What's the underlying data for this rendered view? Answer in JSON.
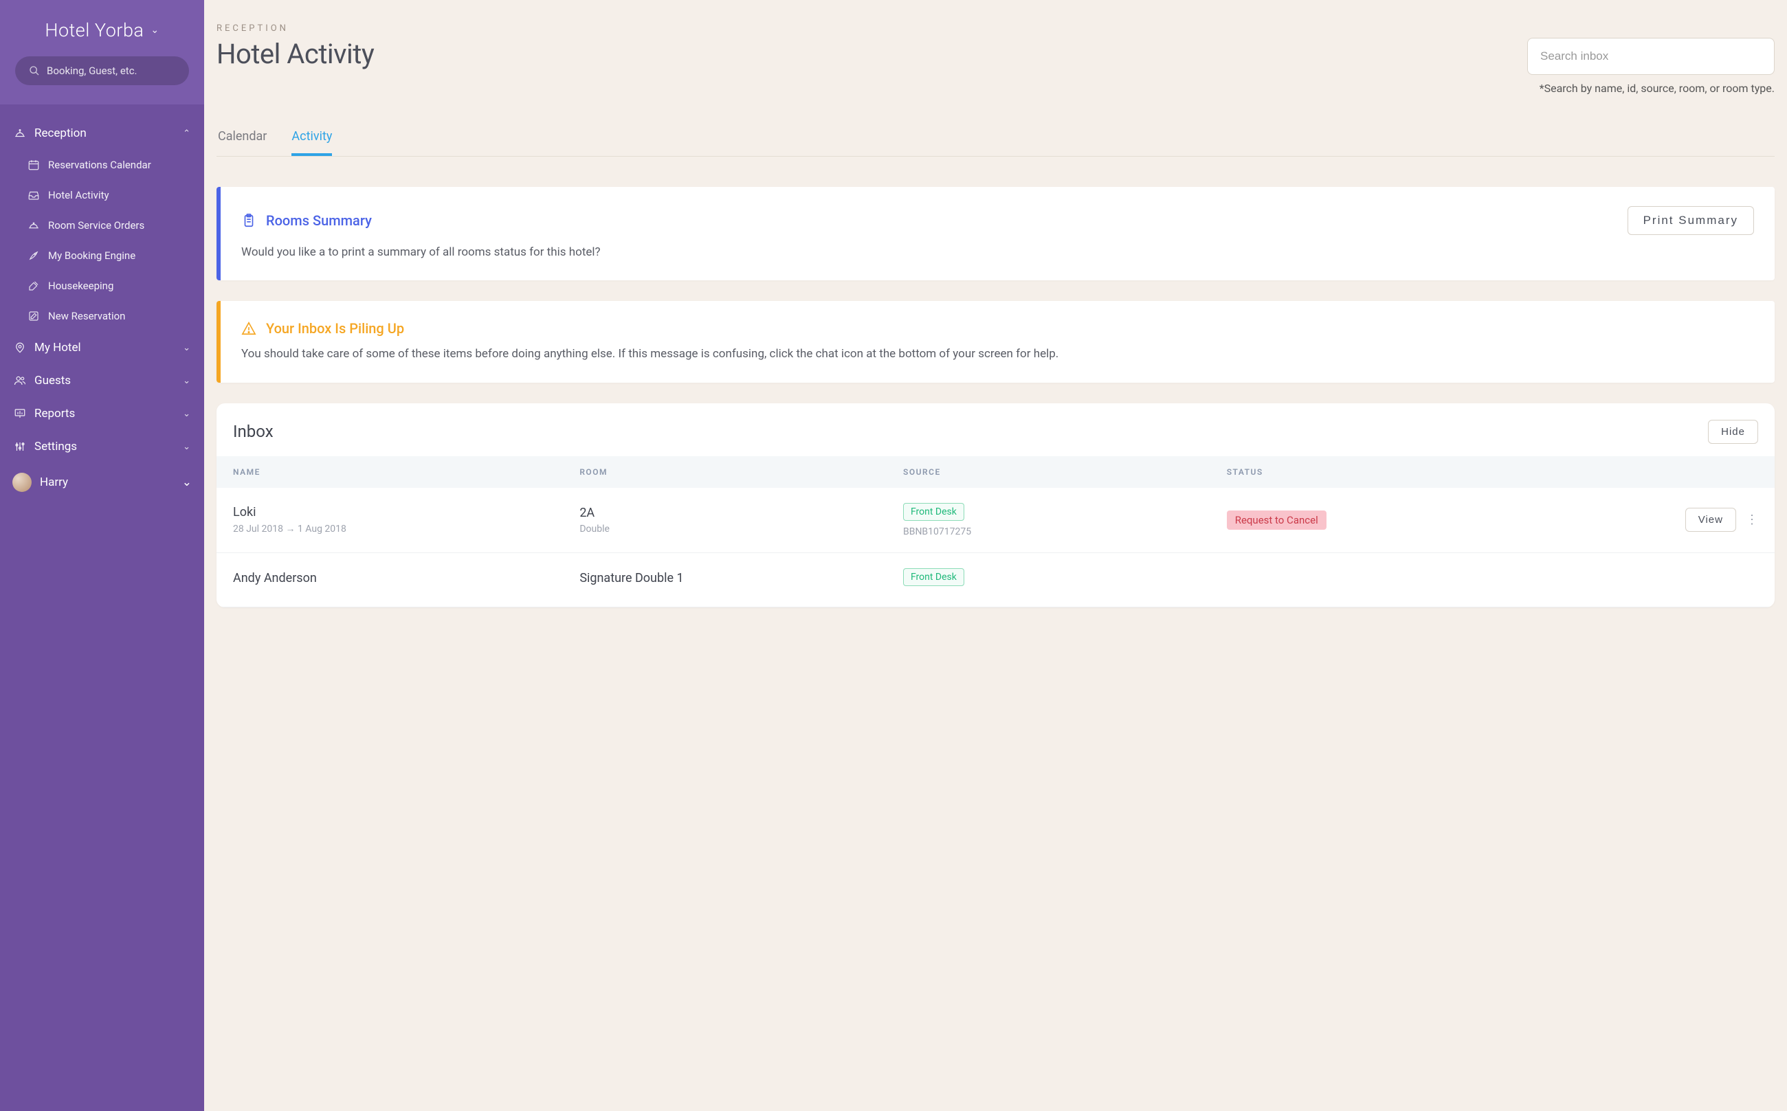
{
  "sidebar": {
    "hotel_name": "Hotel Yorba",
    "search_placeholder": "Booking, Guest, etc.",
    "nav": [
      {
        "label": "Reception",
        "expanded": true,
        "children": [
          {
            "label": "Reservations Calendar"
          },
          {
            "label": "Hotel Activity"
          },
          {
            "label": "Room Service Orders"
          },
          {
            "label": "My Booking Engine"
          },
          {
            "label": "Housekeeping"
          },
          {
            "label": "New Reservation"
          }
        ]
      },
      {
        "label": "My Hotel",
        "expanded": false
      },
      {
        "label": "Guests",
        "expanded": false
      },
      {
        "label": "Reports",
        "expanded": false
      },
      {
        "label": "Settings",
        "expanded": false
      }
    ],
    "user_name": "Harry"
  },
  "main": {
    "breadcrumb": "RECEPTION",
    "title": "Hotel Activity",
    "search_placeholder": "Search inbox",
    "search_hint": "*Search by name, id, source, room, or room type.",
    "tabs": [
      {
        "label": "Calendar",
        "active": false
      },
      {
        "label": "Activity",
        "active": true
      }
    ],
    "cards": {
      "summary": {
        "title": "Rooms Summary",
        "body": "Would you like a to print a summary of all rooms status for this hotel?",
        "action": "Print Summary"
      },
      "alert": {
        "title": "Your Inbox Is Piling Up",
        "body": "You should take care of some of these items before doing anything else. If this message is confusing, click the chat icon at the bottom of your screen for help."
      }
    },
    "inbox": {
      "title": "Inbox",
      "hide_label": "Hide",
      "columns": {
        "name": "NAME",
        "room": "ROOM",
        "source": "SOURCE",
        "status": "STATUS"
      },
      "rows": [
        {
          "name": "Loki",
          "dates": "28 Jul 2018 → 1 Aug 2018",
          "room": "2A",
          "room_type": "Double",
          "source_tag": "Front Desk",
          "source_id": "BBNB10717275",
          "status_badge": "Request to Cancel",
          "action": "View"
        },
        {
          "name": "Andy Anderson",
          "dates": "",
          "room": "Signature Double 1",
          "room_type": "",
          "source_tag": "Front Desk",
          "source_id": "",
          "status_badge": "",
          "action": ""
        }
      ]
    }
  }
}
